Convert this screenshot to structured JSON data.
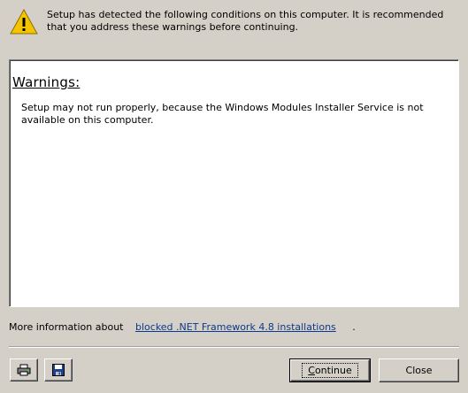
{
  "header": {
    "icon": "warning-icon",
    "message": "Setup has detected the following conditions on this computer. It is recommended that you address these warnings before continuing."
  },
  "warnings": {
    "heading": "Warnings:",
    "items": [
      "Setup may not run properly, because the Windows Modules Installer Service is not available on this computer."
    ]
  },
  "more_info": {
    "prefix": "More information about",
    "link_text": "blocked .NET Framework 4.8 installations",
    "suffix": "."
  },
  "toolbar": {
    "print_icon": "printer-icon",
    "save_icon": "floppy-disk-icon"
  },
  "buttons": {
    "continue": "Continue",
    "close": "Close"
  },
  "colors": {
    "background": "#d4d0c8",
    "link": "#0b3a8f",
    "warning_yellow": "#f5c400"
  }
}
